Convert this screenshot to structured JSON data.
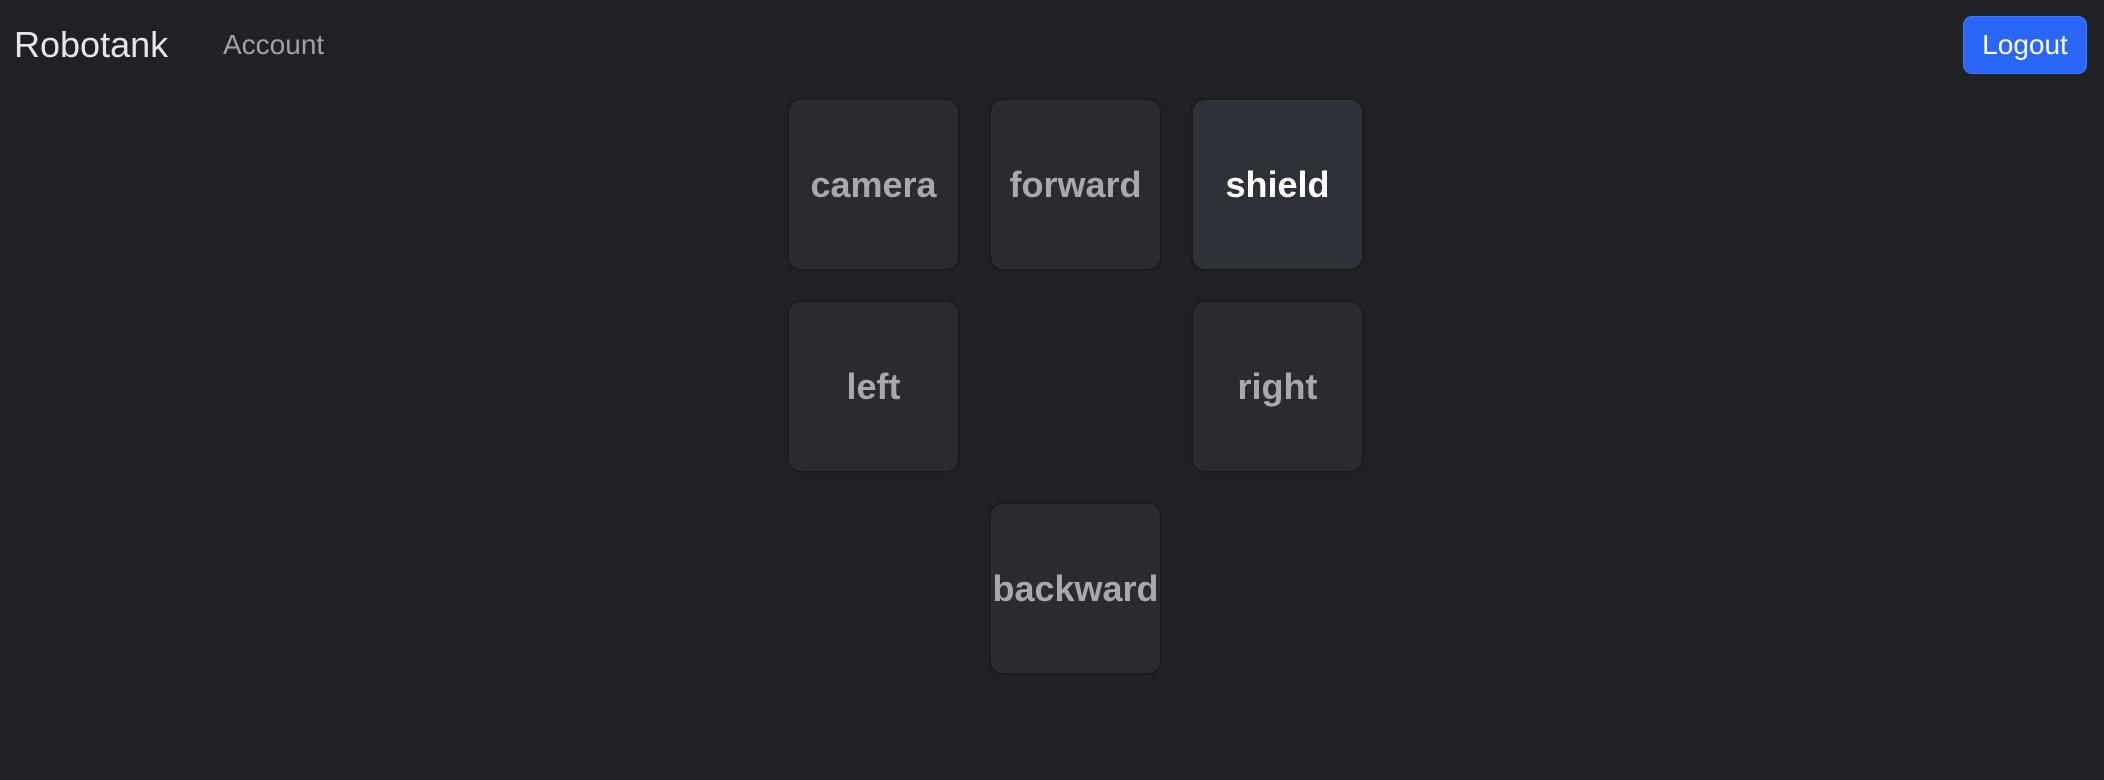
{
  "navbar": {
    "brand": "Robotank",
    "links": [
      {
        "label": "Account"
      }
    ],
    "logout_label": "Logout"
  },
  "controls": {
    "camera": "camera",
    "forward": "forward",
    "shield": "shield",
    "left": "left",
    "right": "right",
    "backward": "backward",
    "active": "shield"
  },
  "colors": {
    "background": "#1f2125",
    "button": "#292b31",
    "button_active": "#2e3138",
    "logout": "#2b67f6"
  }
}
